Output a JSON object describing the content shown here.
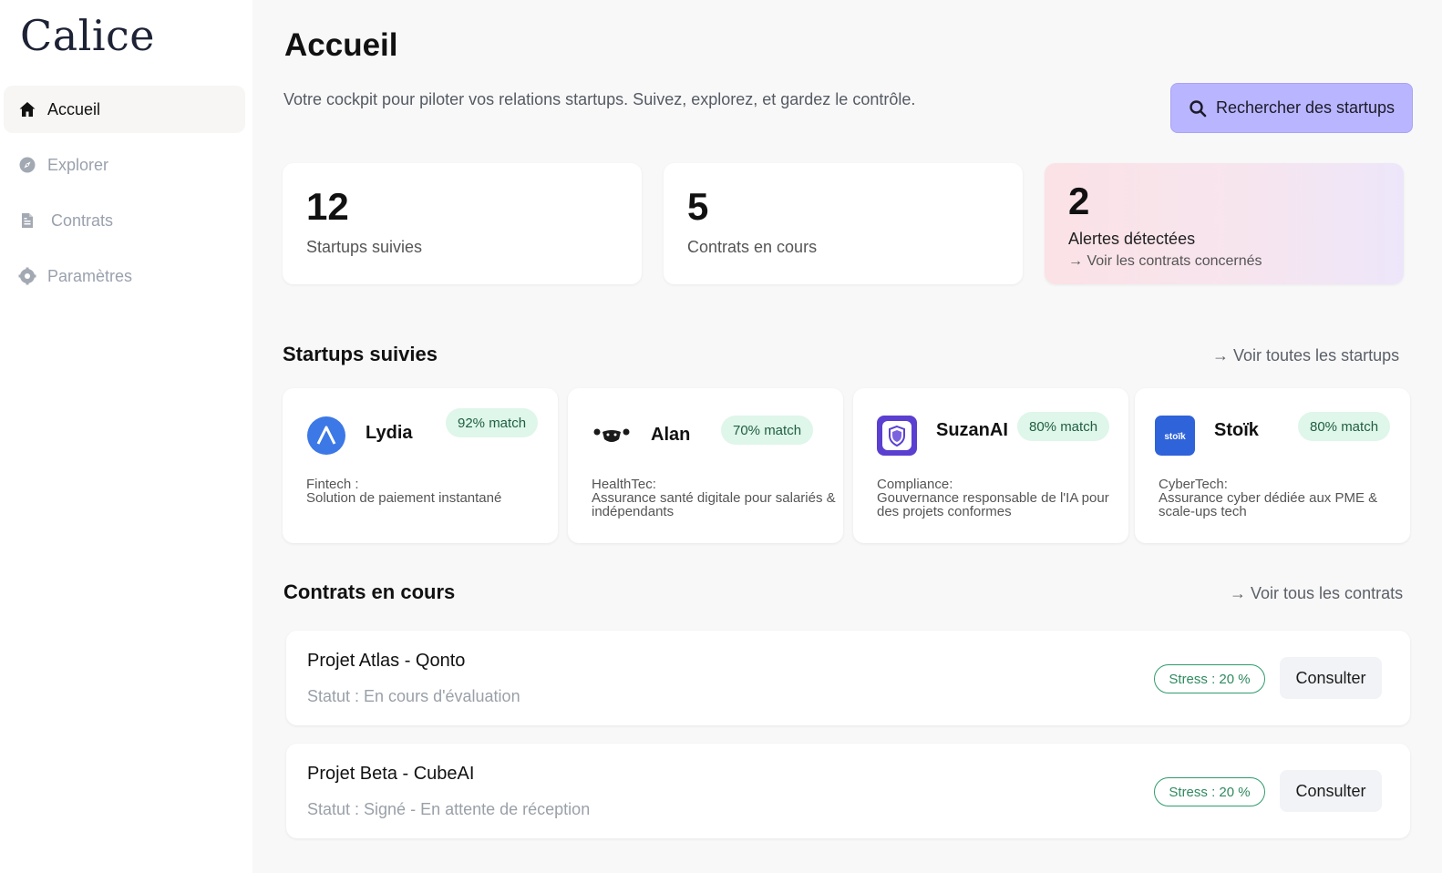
{
  "app": {
    "logo": "Calice"
  },
  "sidebar": {
    "items": [
      {
        "label": "Accueil",
        "icon": "home-icon",
        "active": true
      },
      {
        "label": "Explorer",
        "icon": "compass-icon",
        "active": false
      },
      {
        "label": "Contrats",
        "icon": "document-icon",
        "active": false
      },
      {
        "label": "Paramètres",
        "icon": "gear-icon",
        "active": false
      }
    ]
  },
  "header": {
    "title": "Accueil",
    "subtitle": "Votre cockpit pour piloter vos relations startups. Suivez, explorez, et gardez le contrôle.",
    "search_button": "Rechercher des startups"
  },
  "stats": [
    {
      "value": "12",
      "label": "Startups suivies"
    },
    {
      "value": "5",
      "label": "Contrats en cours"
    },
    {
      "value": "2",
      "label": "Alertes détectées",
      "link": "→ Voir les contrats concernés"
    }
  ],
  "startups_section": {
    "title": "Startups suivies",
    "link": "→ Voir toutes les startups",
    "items": [
      {
        "name": "Lydia",
        "match": "92% match",
        "category": "Fintech :",
        "description": "Solution de paiement instantané",
        "logo_color": "#3c78e6"
      },
      {
        "name": "Alan",
        "match": "70% match",
        "category": "HealthTec:",
        "description": "Assurance santé digitale pour salariés & indépendants",
        "logo_color": "#1a1a1a"
      },
      {
        "name": "SuzanAI",
        "match": "80% match",
        "category": "Compliance:",
        "description": "Gouvernance responsable de l'IA pour des projets conformes",
        "logo_color": "#5b3fd1"
      },
      {
        "name": "Stoïk",
        "match": "80% match",
        "category": "CyberTech:",
        "description": "Assurance cyber dédiée aux PME & scale-ups tech",
        "logo_color": "#2f63d9",
        "logo_text": "stoïk"
      }
    ]
  },
  "contracts_section": {
    "title": "Contrats en cours",
    "link": "→ Voir tous les contrats",
    "items": [
      {
        "name": "Projet Atlas - Qonto",
        "status": "Statut : En cours d'évaluation",
        "stress": "Stress : 20 %",
        "action": "Consulter"
      },
      {
        "name": "Projet Beta - CubeAI",
        "status": "Statut : Signé - En attente de réception",
        "stress": "Stress : 20 %",
        "action": "Consulter"
      }
    ]
  },
  "colors": {
    "accent": "#b9b5ff",
    "match_badge_bg": "#dff6ea",
    "stress_border": "#2f9b6c"
  }
}
